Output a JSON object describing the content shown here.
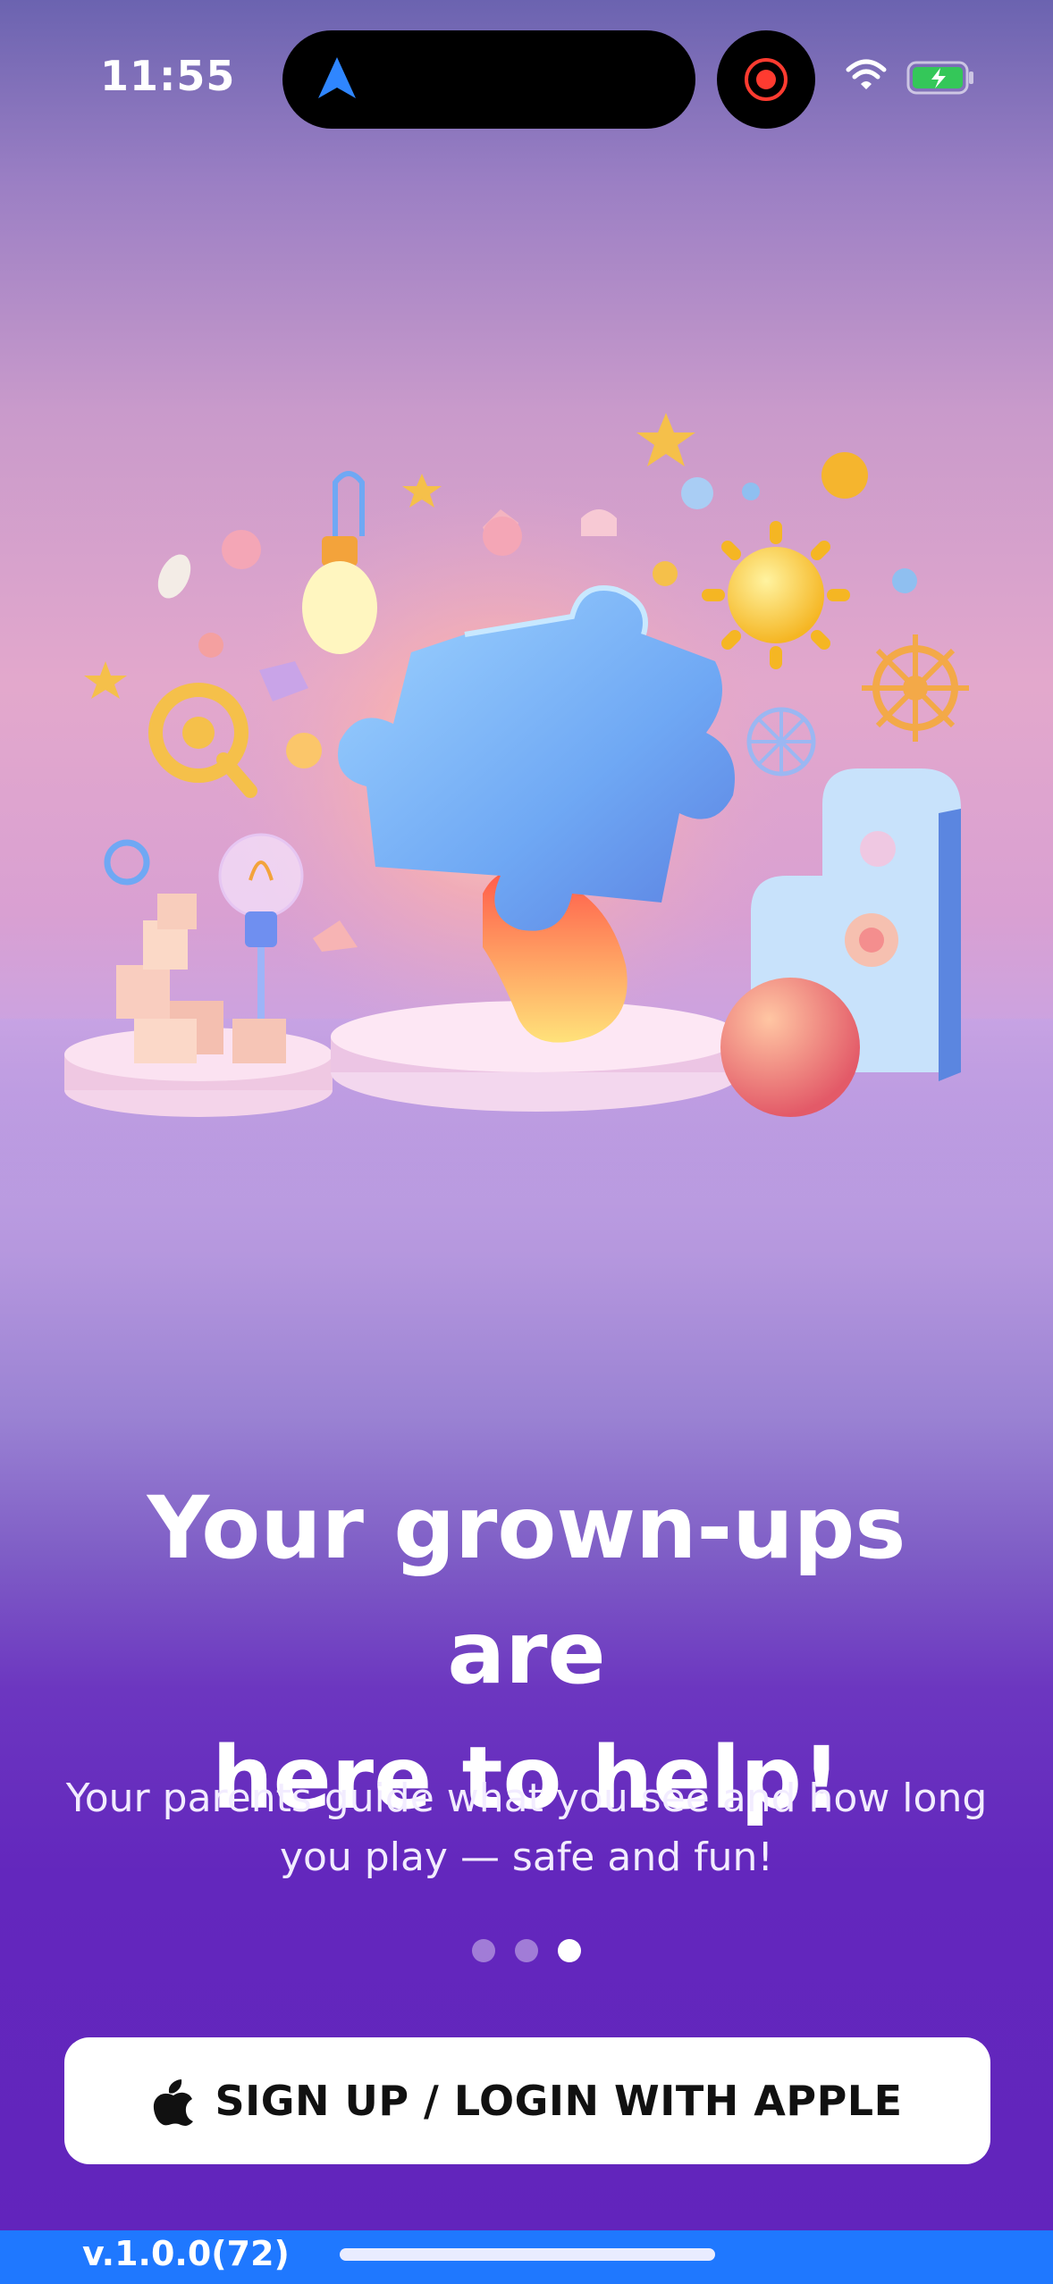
{
  "status_bar": {
    "time": "11:55",
    "icons": [
      "navigation-arrow-icon",
      "screen-record-icon",
      "wifi-icon",
      "battery-charging-icon"
    ]
  },
  "hero": {
    "illustration": "puzzle-piece-toys-illustration"
  },
  "onboarding": {
    "headline_line1": "Your grown-ups are",
    "headline_line2": "here to help!",
    "subtext_line1": "Your parents guide what you see and how long",
    "subtext_line2": "you play — safe and fun!",
    "page_indicator": {
      "total": 3,
      "current": 3
    }
  },
  "auth": {
    "apple_button_label": "SIGN UP / LOGIN WITH APPLE",
    "apple_icon": "apple-logo-icon"
  },
  "footer": {
    "version": "v.1.0.0(72)"
  },
  "colors": {
    "accent_purple": "#6224bc",
    "strip_blue": "#1f78ff",
    "battery_green": "#34c759",
    "record_red": "#ff3b30"
  }
}
